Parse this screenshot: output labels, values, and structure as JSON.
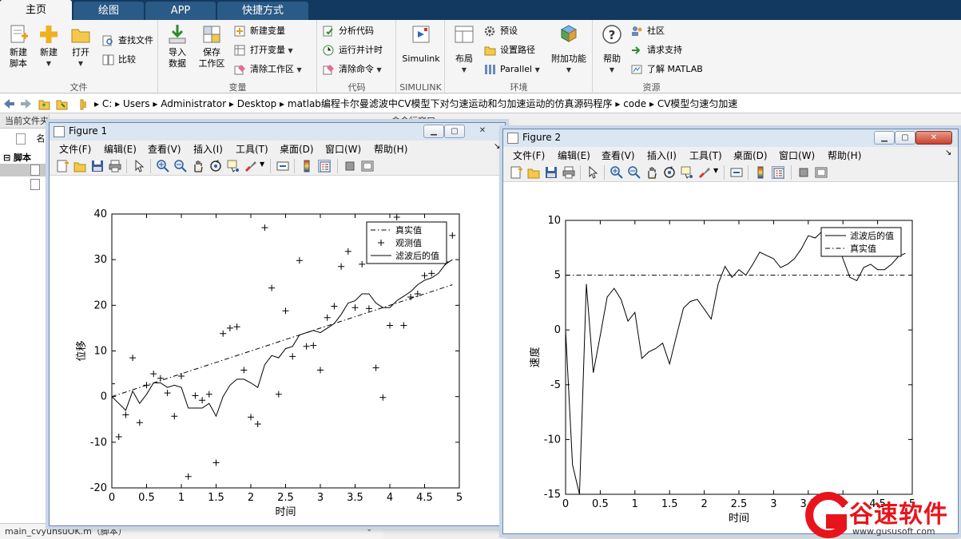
{
  "tabs": [
    {
      "label": "主页",
      "active": true
    },
    {
      "label": "绘图",
      "active": false
    },
    {
      "label": "APP",
      "active": false
    },
    {
      "label": "快捷方式",
      "active": false
    }
  ],
  "ribbon": {
    "file": {
      "label": "文件",
      "new_script": "新建\n脚本",
      "new": "新建",
      "open": "打开",
      "find_files": "查找文件",
      "compare": "比较"
    },
    "variable": {
      "label": "变量",
      "import": "导入\n数据",
      "save_ws": "保存\n工作区",
      "new_var": "新建变量",
      "open_var": "打开变量",
      "clear_ws": "清除工作区"
    },
    "code": {
      "label": "代码",
      "analyze": "分析代码",
      "run_time": "运行并计时",
      "clear_cmd": "清除命令"
    },
    "simulink": {
      "label": "SIMULINK",
      "btn": "Simulink"
    },
    "env": {
      "label": "环境",
      "layout": "布局",
      "prefs": "预设",
      "set_path": "设置路径",
      "parallel": "Parallel",
      "addons": "附加功能"
    },
    "resources": {
      "label": "资源",
      "help": "帮助",
      "community": "社区",
      "support": "请求支持",
      "learn": "了解 MATLAB"
    }
  },
  "address": {
    "segments": [
      "C:",
      "Users",
      "Administrator",
      "Desktop",
      "matlab编程卡尔曼滤波中CV模型下对匀速运动和匀加速运动的仿真源码程序",
      "code",
      "CV模型匀速匀加速"
    ]
  },
  "left_panel": {
    "title": "当前文件夹",
    "col_name": "名",
    "section": "脚本",
    "status": "main_cvyunsuOK.m（脚本）"
  },
  "cmd_window_label": "命令行窗口",
  "figure1": {
    "title": "Figure 1",
    "menu": [
      "文件(F)",
      "编辑(E)",
      "查看(V)",
      "插入(I)",
      "工具(T)",
      "桌面(D)",
      "窗口(W)",
      "帮助(H)"
    ]
  },
  "figure2": {
    "title": "Figure 2",
    "menu": [
      "文件(F)",
      "编辑(E)",
      "查看(V)",
      "插入(I)",
      "工具(T)",
      "桌面(D)",
      "窗口(W)",
      "帮助(H)"
    ]
  },
  "watermark": {
    "text": "谷速软件",
    "url": "www.gususoft.com",
    "color": "#e8141c"
  },
  "chart_data": [
    {
      "type": "line",
      "xlabel": "时间",
      "ylabel": "位移",
      "xlim": [
        0,
        5
      ],
      "ylim": [
        -20,
        40
      ],
      "xticks": [
        0,
        0.5,
        1,
        1.5,
        2,
        2.5,
        3,
        3.5,
        4,
        4.5,
        5
      ],
      "yticks": [
        -20,
        -10,
        0,
        10,
        20,
        30,
        40
      ],
      "legend_position": "top-right",
      "series": [
        {
          "name": "真实值",
          "style": "dashdot",
          "x": [
            0,
            4.9
          ],
          "y": [
            0,
            24.5
          ]
        },
        {
          "name": "观测值",
          "style": "plus",
          "x": [
            0.0,
            0.1,
            0.2,
            0.3,
            0.4,
            0.5,
            0.6,
            0.7,
            0.8,
            0.9,
            1.0,
            1.1,
            1.2,
            1.3,
            1.4,
            1.5,
            1.6,
            1.7,
            1.8,
            1.9,
            2.0,
            2.1,
            2.2,
            2.3,
            2.4,
            2.5,
            2.6,
            2.7,
            2.8,
            2.9,
            3.0,
            3.1,
            3.2,
            3.3,
            3.4,
            3.5,
            3.6,
            3.7,
            3.8,
            3.9,
            4.0,
            4.1,
            4.2,
            4.3,
            4.4,
            4.5,
            4.6,
            4.7,
            4.8,
            4.9
          ],
          "y": [
            2.8,
            -8.8,
            -4.0,
            8.5,
            -5.7,
            2.5,
            5.0,
            4.0,
            0.8,
            -4.3,
            4.5,
            -17.5,
            0.2,
            -0.8,
            0.5,
            -14.5,
            13.8,
            15.0,
            15.3,
            5.8,
            -4.5,
            -6.0,
            37.0,
            23.8,
            0.5,
            18.8,
            8.8,
            29.8,
            11.0,
            11.2,
            5.8,
            17.3,
            19.8,
            28.5,
            31.8,
            19.5,
            29.0,
            19.3,
            6.3,
            -0.2,
            15.6,
            39.3,
            15.6,
            21.8,
            22.5,
            26.5,
            27.0,
            31.0,
            29.5,
            35.3
          ]
        },
        {
          "name": "滤波后的值",
          "style": "solid",
          "x": [
            0.0,
            0.1,
            0.2,
            0.3,
            0.4,
            0.5,
            0.6,
            0.7,
            0.8,
            0.9,
            1.0,
            1.1,
            1.2,
            1.3,
            1.4,
            1.5,
            1.6,
            1.7,
            1.8,
            1.9,
            2.0,
            2.1,
            2.2,
            2.3,
            2.4,
            2.5,
            2.6,
            2.7,
            2.8,
            2.9,
            3.0,
            3.1,
            3.2,
            3.3,
            3.4,
            3.5,
            3.6,
            3.7,
            3.8,
            3.9,
            4.0,
            4.1,
            4.2,
            4.3,
            4.4,
            4.5,
            4.6,
            4.7,
            4.8,
            4.9
          ],
          "y": [
            0.0,
            -1.5,
            -3.0,
            1.2,
            -1.5,
            0.5,
            3.0,
            3.0,
            2.0,
            2.5,
            2.0,
            -2.5,
            -2.5,
            -2.5,
            -1.5,
            -4.3,
            0.0,
            2.5,
            3.8,
            3.8,
            3.0,
            2.0,
            7.0,
            9.0,
            8.5,
            10.5,
            11.0,
            13.5,
            14.0,
            14.5,
            14.0,
            15.0,
            16.0,
            18.0,
            20.5,
            21.0,
            22.5,
            22.5,
            20.5,
            19.5,
            19.5,
            21.0,
            22.0,
            23.0,
            24.5,
            25.5,
            26.0,
            27.0,
            29.0,
            30.0
          ]
        }
      ]
    },
    {
      "type": "line",
      "xlabel": "时间",
      "ylabel": "速度",
      "xlim": [
        0,
        5
      ],
      "ylim": [
        -15,
        10
      ],
      "xticks": [
        0,
        0.5,
        1,
        1.5,
        2,
        2.5,
        3,
        3.5,
        4,
        4.5,
        5
      ],
      "yticks": [
        -15,
        -10,
        -5,
        0,
        5,
        10
      ],
      "legend_position": "top-right",
      "series": [
        {
          "name": "滤波后的值",
          "style": "solid",
          "x": [
            0.0,
            0.1,
            0.2,
            0.3,
            0.4,
            0.5,
            0.6,
            0.7,
            0.8,
            0.9,
            1.0,
            1.1,
            1.2,
            1.3,
            1.4,
            1.5,
            1.6,
            1.7,
            1.8,
            1.9,
            2.0,
            2.1,
            2.2,
            2.3,
            2.4,
            2.5,
            2.6,
            2.7,
            2.8,
            2.9,
            3.0,
            3.1,
            3.2,
            3.3,
            3.4,
            3.5,
            3.6,
            3.7,
            3.8,
            3.9,
            4.0,
            4.1,
            4.2,
            4.3,
            4.4,
            4.5,
            4.6,
            4.7,
            4.8,
            4.9
          ],
          "y": [
            0.0,
            -12.3,
            -15.0,
            4.2,
            -3.9,
            -0.5,
            3.0,
            3.8,
            2.8,
            0.8,
            1.6,
            -2.6,
            -2.0,
            -1.7,
            -1.2,
            -3.1,
            -0.5,
            2.0,
            2.6,
            2.8,
            1.9,
            1.0,
            4.2,
            5.8,
            4.8,
            5.5,
            5.0,
            6.0,
            7.1,
            6.8,
            6.5,
            5.7,
            6.0,
            6.5,
            7.4,
            8.6,
            8.4,
            9.0,
            8.8,
            8.5,
            6.5,
            4.8,
            4.5,
            5.7,
            6.0,
            5.5,
            5.5,
            6.0,
            6.7,
            7.0
          ]
        },
        {
          "name": "真实值",
          "style": "dashdot",
          "x": [
            0,
            4.9
          ],
          "y": [
            5,
            5
          ]
        }
      ]
    }
  ]
}
